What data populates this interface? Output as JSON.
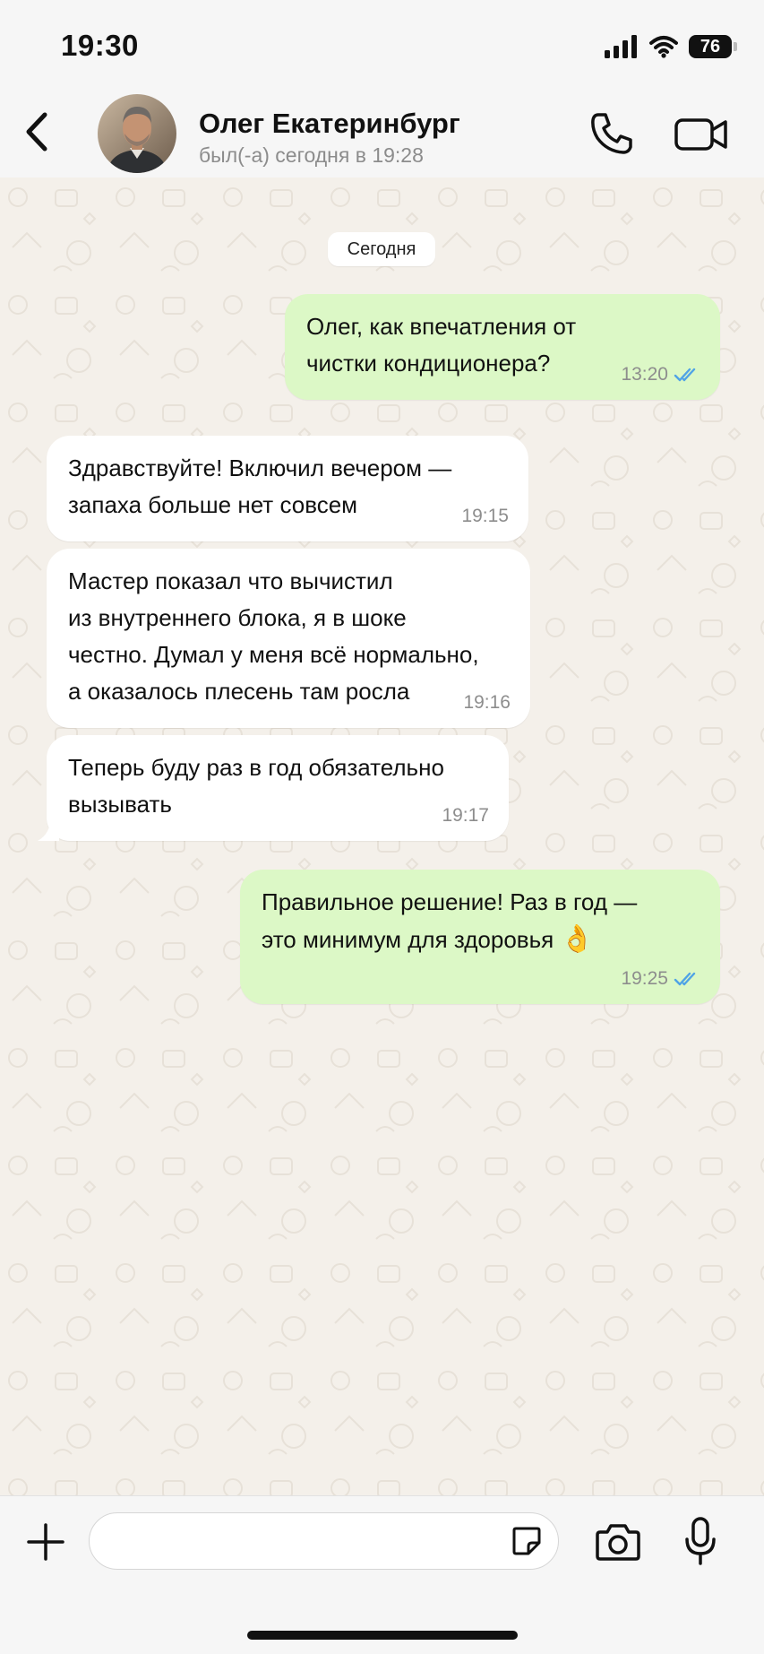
{
  "status_bar": {
    "time": "19:30",
    "battery": "76",
    "icons": [
      "cellular-signal-icon",
      "wifi-icon",
      "battery-icon"
    ]
  },
  "header": {
    "contact_name": "Олег Екатеринбург",
    "last_seen": "был(-а) сегодня в 19:28",
    "icons": [
      "back-chevron-icon",
      "avatar",
      "phone-icon",
      "video-camera-icon"
    ]
  },
  "chat": {
    "date_separator": "Сегодня",
    "messages": [
      {
        "direction": "outgoing",
        "text": "Олег, как впечатления от\nчистки кондиционера?",
        "time": "13:20",
        "status": "read"
      },
      {
        "direction": "incoming",
        "text": "Здравствуйте! Включил вечером —\nзапаха больше нет совсем",
        "time": "19:15"
      },
      {
        "direction": "incoming",
        "text": "Мастер показал что вычистил\nиз внутреннего блока, я в шоке\nчестно. Думал у меня всё нормально,\nа оказалось плесень там росла",
        "time": "19:16"
      },
      {
        "direction": "incoming",
        "text": "Теперь буду раз в год обязательно\nвызывать",
        "time": "19:17"
      },
      {
        "direction": "outgoing",
        "text": "Правильное решение! Раз в год —\nэто минимум для здоровья",
        "emoji": "👌",
        "time": "19:25",
        "status": "read"
      }
    ]
  },
  "composer": {
    "input_value": "",
    "icons": [
      "plus-icon",
      "sticker-icon",
      "camera-icon",
      "microphone-icon"
    ]
  },
  "colors": {
    "outgoing_bubble": "#dcf8c6",
    "incoming_bubble": "#ffffff",
    "chat_background": "#f4f0ea",
    "read_ticks": "#4fa3e6",
    "bar_background": "#f6f6f6"
  }
}
